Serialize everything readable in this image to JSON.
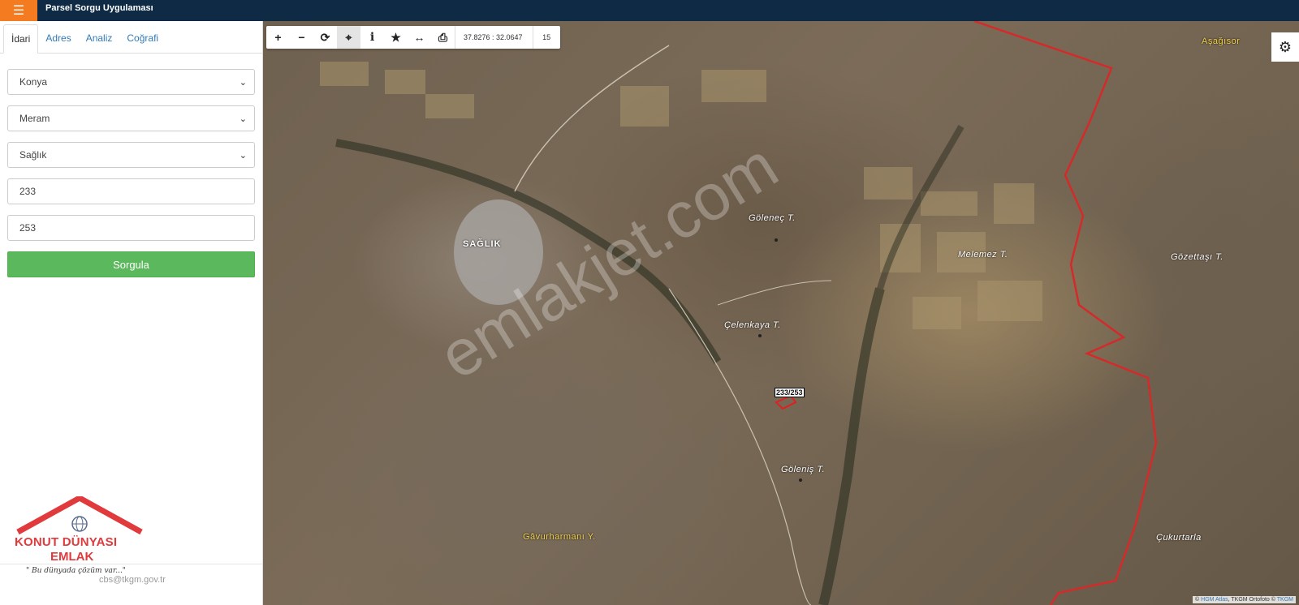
{
  "header": {
    "menu_icon": "hamburger-icon",
    "title": "Parsel Sorgu Uygulaması"
  },
  "sidebar": {
    "tabs": [
      "İdari",
      "Adres",
      "Analiz",
      "Coğrafi"
    ],
    "active_tab": "İdari",
    "province": "Konya",
    "district": "Meram",
    "neighborhood": "Sağlık",
    "block": "233",
    "parcel": "253",
    "submit_label": "Sorgula",
    "footer_email": "cbs@tkgm.gov.tr"
  },
  "logo": {
    "line1": "KONUT DÜNYASI",
    "line2": "EMLAK",
    "slogan": "\" Bu dünyada çözüm var...\""
  },
  "map": {
    "coordinates": "37.8276 : 32.0647",
    "zoom": "15",
    "labels": {
      "village": "SAĞLIK",
      "golenec": "Göleneç T.",
      "melemez": "Melemez T.",
      "gozettasi": "Gözettaşı T.",
      "celenkaya": "Çelenkaya T.",
      "golenis": "Göleniş T.",
      "gavurharmani": "Gâvurharmanı Y.",
      "cukurtarla": "Çukurtarla",
      "asagisor": "Aşağısor"
    },
    "parcel_label": "233/253",
    "watermark": "emlakjet.com",
    "attribution_prefix": "©",
    "attribution_link1": "HGM Atlas",
    "attribution_middle": ", TKGM Ortofoto ©",
    "attribution_link2": "TKGM",
    "boundary_color": "#d42a2a",
    "accent_color": "#f47b20",
    "submit_color": "#5cb85c"
  },
  "toolbar_icons": [
    "plus-icon",
    "minus-icon",
    "refresh-icon",
    "crosshair-icon",
    "info-icon",
    "star-icon",
    "measure-icon",
    "print-icon"
  ]
}
